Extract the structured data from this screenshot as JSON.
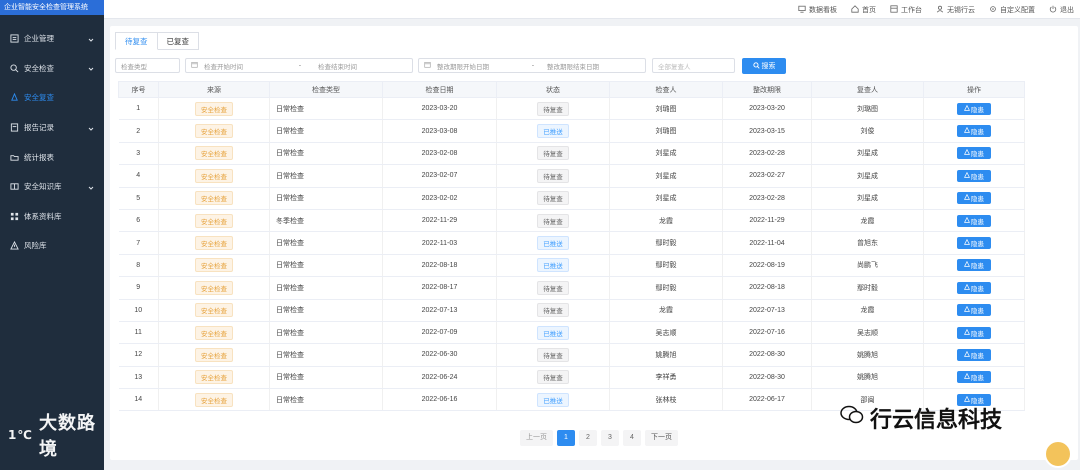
{
  "app": {
    "title": "企业智能安全检查管理系统"
  },
  "sidebar": {
    "items": [
      {
        "label": "企业管理",
        "icon": "building-icon",
        "has_arrow": true,
        "active": false
      },
      {
        "label": "安全检查",
        "icon": "inspect-icon",
        "has_arrow": true,
        "active": false
      },
      {
        "label": "安全复查",
        "icon": "review-icon",
        "has_arrow": false,
        "active": true
      },
      {
        "label": "报告记录",
        "icon": "report-icon",
        "has_arrow": true,
        "active": false
      },
      {
        "label": "统计报表",
        "icon": "folder-icon",
        "has_arrow": false,
        "active": false
      },
      {
        "label": "安全知识库",
        "icon": "book-icon",
        "has_arrow": true,
        "active": false
      },
      {
        "label": "体系资料库",
        "icon": "grid-icon",
        "has_arrow": false,
        "active": false
      },
      {
        "label": "风险库",
        "icon": "warning-icon",
        "has_arrow": false,
        "active": false
      }
    ]
  },
  "topnav": {
    "items": [
      {
        "label": "数据看板",
        "icon": "monitor-icon"
      },
      {
        "label": "首页",
        "icon": "home-icon"
      },
      {
        "label": "工作台",
        "icon": "workbench-icon"
      },
      {
        "label": "无锡行云",
        "icon": "user-icon"
      },
      {
        "label": "自定义配置",
        "icon": "gear-icon"
      },
      {
        "label": "退出",
        "icon": "power-icon"
      }
    ]
  },
  "tabs": [
    {
      "label": "待复查",
      "active": true
    },
    {
      "label": "已复查",
      "active": false
    }
  ],
  "filters": {
    "check_type_placeholder": "检查类型",
    "check_start_placeholder": "检查开始时间",
    "check_end_placeholder": "检查结束时间",
    "rectify_start_placeholder": "整改期限开始日期",
    "rectify_end_placeholder": "整改期限结束日期",
    "separator": "-",
    "reviewer_placeholder": "全部复查人",
    "search_label": "搜索"
  },
  "table": {
    "headers": [
      "序号",
      "来源",
      "检查类型",
      "检查日期",
      "状态",
      "检查人",
      "整改期限",
      "复查人",
      "操作"
    ],
    "action_label": "隐患",
    "status_pending": "待复查",
    "status_done": "已推送",
    "rows": [
      {
        "no": "1",
        "source": "安全检查",
        "type": "日常检查",
        "date": "2023-03-20",
        "status": "待复查",
        "inspector": "刘璐图",
        "deadline": "2023-03-20",
        "reviewer": "刘璐图"
      },
      {
        "no": "2",
        "source": "安全检查",
        "type": "日常检查",
        "date": "2023-03-08",
        "status": "已推送",
        "inspector": "刘璐图",
        "deadline": "2023-03-15",
        "reviewer": "刘俊"
      },
      {
        "no": "3",
        "source": "安全检查",
        "type": "日常检查",
        "date": "2023-02-08",
        "status": "待复查",
        "inspector": "刘星成",
        "deadline": "2023-02-28",
        "reviewer": "刘星成"
      },
      {
        "no": "4",
        "source": "安全检查",
        "type": "日常检查",
        "date": "2023-02-07",
        "status": "待复查",
        "inspector": "刘星成",
        "deadline": "2023-02-27",
        "reviewer": "刘星成"
      },
      {
        "no": "5",
        "source": "安全检查",
        "type": "日常检查",
        "date": "2023-02-02",
        "status": "待复查",
        "inspector": "刘星成",
        "deadline": "2023-02-28",
        "reviewer": "刘星成"
      },
      {
        "no": "6",
        "source": "安全检查",
        "type": "冬季检查",
        "date": "2022-11-29",
        "status": "待复查",
        "inspector": "龙霞",
        "deadline": "2022-11-29",
        "reviewer": "龙霞"
      },
      {
        "no": "7",
        "source": "安全检查",
        "type": "日常检查",
        "date": "2022-11-03",
        "status": "已推送",
        "inspector": "鄢时毅",
        "deadline": "2022-11-04",
        "reviewer": "曾旭东"
      },
      {
        "no": "8",
        "source": "安全检查",
        "type": "日常检查",
        "date": "2022-08-18",
        "status": "已推送",
        "inspector": "鄢时毅",
        "deadline": "2022-08-19",
        "reviewer": "尚鹏飞"
      },
      {
        "no": "9",
        "source": "安全检查",
        "type": "日常检查",
        "date": "2022-08-17",
        "status": "待复查",
        "inspector": "鄢时毅",
        "deadline": "2022-08-18",
        "reviewer": "鄢时毅"
      },
      {
        "no": "10",
        "source": "安全检查",
        "type": "日常检查",
        "date": "2022-07-13",
        "status": "待复查",
        "inspector": "龙霞",
        "deadline": "2022-07-13",
        "reviewer": "龙霞"
      },
      {
        "no": "11",
        "source": "安全检查",
        "type": "日常检查",
        "date": "2022-07-09",
        "status": "已推送",
        "inspector": "吴志顺",
        "deadline": "2022-07-16",
        "reviewer": "吴志顺"
      },
      {
        "no": "12",
        "source": "安全检查",
        "type": "日常检查",
        "date": "2022-06-30",
        "status": "待复查",
        "inspector": "姚腾旭",
        "deadline": "2022-08-30",
        "reviewer": "姚腾旭"
      },
      {
        "no": "13",
        "source": "安全检查",
        "type": "日常检查",
        "date": "2022-06-24",
        "status": "待复查",
        "inspector": "李祥勇",
        "deadline": "2022-08-30",
        "reviewer": "姚腾旭"
      },
      {
        "no": "14",
        "source": "安全检查",
        "type": "日常检查",
        "date": "2022-06-16",
        "status": "已推送",
        "inspector": "张林枝",
        "deadline": "2022-06-17",
        "reviewer": "邵闽"
      }
    ]
  },
  "pager": {
    "prev": "上一页",
    "next": "下一页",
    "pages": [
      "1",
      "2",
      "3",
      "4"
    ],
    "current": "1"
  },
  "watermarks": {
    "left": "大数路境",
    "right": "行云信息科技"
  },
  "colors": {
    "primary": "#2d8cf0",
    "sidebar": "#1f2d3d",
    "brand_bar": "#2b6ed8",
    "source_tag": "#e6a23c"
  }
}
